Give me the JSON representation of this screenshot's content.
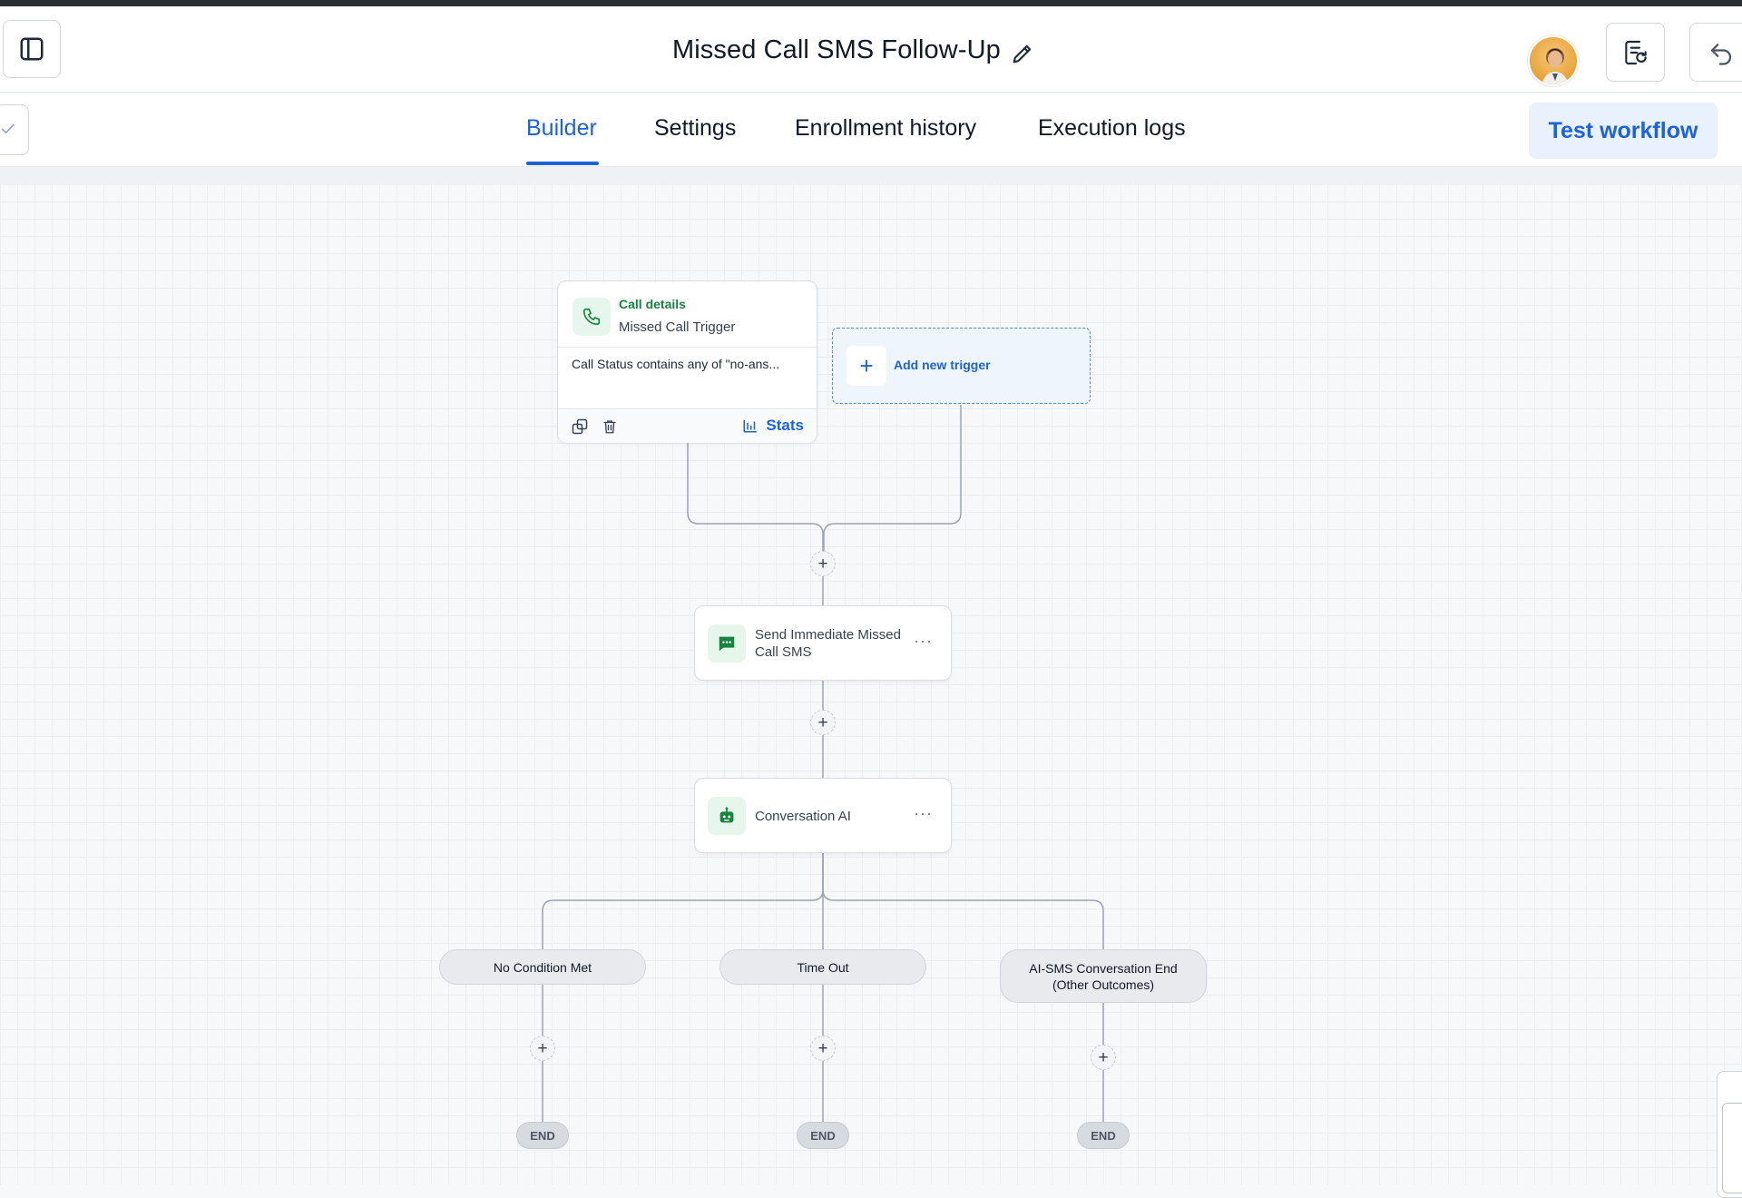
{
  "header": {
    "title": "Missed Call SMS Follow-Up"
  },
  "tabs": [
    {
      "label": "Builder",
      "active": true
    },
    {
      "label": "Settings",
      "active": false
    },
    {
      "label": "Enrollment history",
      "active": false
    },
    {
      "label": "Execution logs",
      "active": false
    }
  ],
  "actions": {
    "test_workflow_label": "Test workflow"
  },
  "trigger": {
    "kicker": "Call details",
    "name": "Missed Call Trigger",
    "condition": "Call Status contains any of \"no-ans...",
    "stats_label": "Stats"
  },
  "add_trigger": {
    "label": "Add new trigger"
  },
  "steps": [
    {
      "label": "Send Immediate Missed Call SMS",
      "icon": "sms-icon"
    },
    {
      "label": "Conversation AI",
      "icon": "robot-icon"
    }
  ],
  "branches": [
    {
      "label": "No Condition Met"
    },
    {
      "label": "Time Out"
    },
    {
      "label": "AI-SMS Conversation End (Other Outcomes)"
    }
  ],
  "end_label": "END",
  "colors": {
    "accent": "#1d62d8",
    "accent_bg": "#e8f1fd",
    "green": "#16833f",
    "green_bg": "#e7f6ec"
  }
}
